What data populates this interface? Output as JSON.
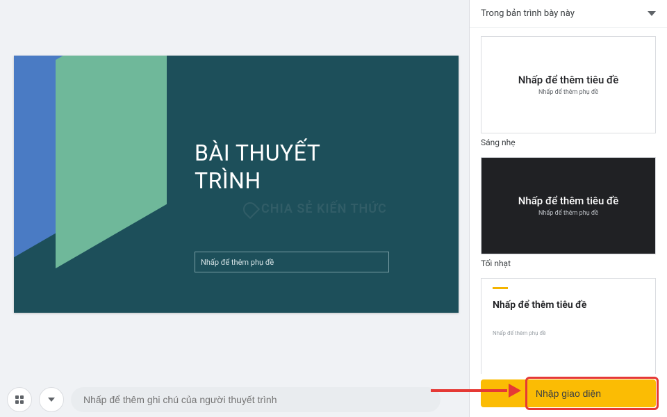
{
  "slide": {
    "title": "BÀI THUYẾT\nTRÌNH",
    "subtitle_placeholder": "Nhấp để thêm phụ đề",
    "watermark": "CHIA SẺ KIẾN THỨC"
  },
  "bottom": {
    "notes_placeholder": "Nhấp để thêm ghi chú của người thuyết trình"
  },
  "panel": {
    "header": "Trong bản trình bày này",
    "themes": [
      {
        "title": "Nhấp để thêm tiêu đề",
        "subtitle": "Nhấp để thêm phụ đề",
        "label": "Sáng nhẹ",
        "variant": "light"
      },
      {
        "title": "Nhấp để thêm tiêu đề",
        "subtitle": "Nhấp để thêm phụ đề",
        "label": "Tối nhạt",
        "variant": "dark"
      },
      {
        "title": "Nhấp để thêm tiêu đề",
        "subtitle": "Nhấp để thêm phụ đề",
        "label": "",
        "variant": "accent"
      }
    ],
    "import_button": "Nhập giao diện"
  }
}
